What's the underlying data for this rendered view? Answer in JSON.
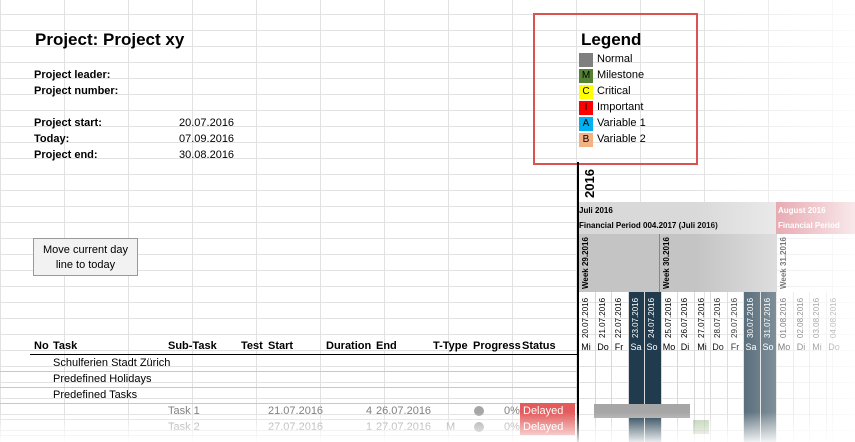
{
  "project": {
    "title": "Project: Project xy",
    "leader_label": "Project leader:",
    "number_label": "Project number:",
    "start_label": "Project start:",
    "start_value": "20.07.2016",
    "today_label": "Today:",
    "today_value": "07.09.2016",
    "end_label": "Project end:",
    "end_value": "30.08.2016"
  },
  "legend": {
    "title": "Legend",
    "items": [
      {
        "letter": "",
        "label": "Normal",
        "color": "#7f7f7f"
      },
      {
        "letter": "M",
        "label": "Milestone",
        "color": "#548235"
      },
      {
        "letter": "C",
        "label": "Critical",
        "color": "#ffff00"
      },
      {
        "letter": "I",
        "label": "Important",
        "color": "#ff0000"
      },
      {
        "letter": "A",
        "label": "Variable 1",
        "color": "#00b0f0"
      },
      {
        "letter": "B",
        "label": "Variable 2",
        "color": "#f4b183"
      }
    ]
  },
  "button": {
    "label": "Move current day line to today"
  },
  "table": {
    "headers": [
      "No",
      "Task",
      "Sub-Task",
      "Test",
      "Start",
      "Duration",
      "End",
      "T-Type",
      "Progress",
      "Status"
    ],
    "groups": [
      "Schulferien Stadt Zürich",
      "Predefined Holidays",
      "Predefined Tasks"
    ],
    "tasks": [
      {
        "sub": "Task 1",
        "start": "21.07.2016",
        "duration": "4",
        "end": "26.07.2016",
        "ttype": "",
        "progress": "0%",
        "status": "Delayed"
      },
      {
        "sub": "Task 2",
        "start": "27.07.2016",
        "duration": "1",
        "end": "27.07.2016",
        "ttype": "M",
        "progress": "0%",
        "status": "Delayed"
      }
    ]
  },
  "timeline": {
    "year": "2016",
    "month_july": "Juli 2016",
    "period_july": "Financial Period 004.2017 (Juli 2016)",
    "month_aug": "August 2016",
    "period_aug": "Financial Period",
    "weeks": [
      "Week 29.2016",
      "Week 30.2016",
      "Week 31.2016"
    ],
    "dates": [
      "20.07.2016",
      "21.07.2016",
      "22.07.2016",
      "23.07.2016",
      "24.07.2016",
      "25.07.2016",
      "26.07.2016",
      "27.07.2016",
      "28.07.2016",
      "29.07.2016",
      "30.07.2016",
      "31.07.2016",
      "01.08.2016",
      "02.08.2016",
      "03.08.2016",
      "04.08.2016"
    ],
    "days": [
      "Mi",
      "Do",
      "Fr",
      "Sa",
      "So",
      "Mo",
      "Di",
      "Mi",
      "Do",
      "Fr",
      "Sa",
      "So",
      "Mo",
      "Di",
      "Mi",
      "Do"
    ]
  }
}
